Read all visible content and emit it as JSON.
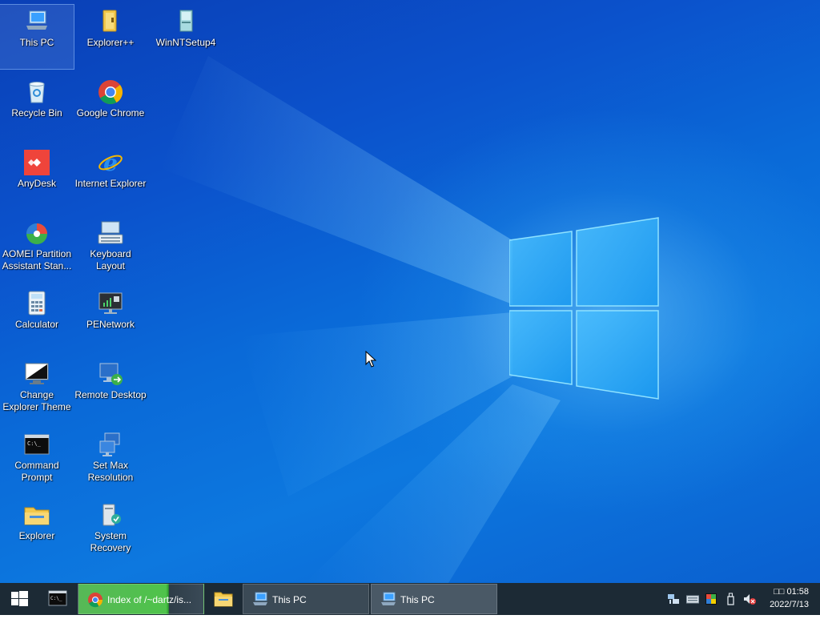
{
  "desktop": {
    "icons": [
      {
        "id": "this-pc",
        "label": "This PC",
        "icon": "computer-icon"
      },
      {
        "id": "explorerpp",
        "label": "Explorer++",
        "icon": "folder-icon"
      },
      {
        "id": "winntsetup",
        "label": "WinNTSetup4",
        "icon": "setup-disc-icon"
      },
      {
        "id": "recycle-bin",
        "label": "Recycle Bin",
        "icon": "recycle-bin-icon"
      },
      {
        "id": "google-chrome",
        "label": "Google Chrome",
        "icon": "chrome-icon"
      },
      {
        "id": "anydesk",
        "label": "AnyDesk",
        "icon": "anydesk-icon"
      },
      {
        "id": "internet-explorer",
        "label": "Internet Explorer",
        "icon": "ie-icon"
      },
      {
        "id": "aomei",
        "label": "AOMEI Partition Assistant Stan...",
        "icon": "aomei-icon"
      },
      {
        "id": "keyboard-layout",
        "label": "Keyboard Layout",
        "icon": "keyboard-icon"
      },
      {
        "id": "calculator",
        "label": "Calculator",
        "icon": "calculator-icon"
      },
      {
        "id": "penetwork",
        "label": "PENetwork",
        "icon": "network-monitor-icon"
      },
      {
        "id": "change-explorer-theme",
        "label": "Change Explorer Theme",
        "icon": "theme-icon"
      },
      {
        "id": "remote-desktop",
        "label": "Remote Desktop",
        "icon": "remote-desktop-icon"
      },
      {
        "id": "command-prompt",
        "label": "Command Prompt",
        "icon": "cmd-icon"
      },
      {
        "id": "set-max-resolution",
        "label": "Set Max Resolution",
        "icon": "resolution-icon"
      },
      {
        "id": "explorer",
        "label": "Explorer",
        "icon": "folder-icon"
      },
      {
        "id": "system-recovery",
        "label": "System Recovery",
        "icon": "recovery-icon"
      }
    ]
  },
  "taskbar": {
    "start_icon": "windows-start-icon",
    "pinned_cmd_icon": "cmd-icon",
    "tasks": [
      {
        "label": "Index of /~dartz/is...",
        "icon": "chrome-icon",
        "active": true
      },
      {
        "label": "This PC",
        "icon": "computer-icon",
        "active": false
      },
      {
        "label": "This PC",
        "icon": "computer-icon",
        "active": false
      }
    ],
    "tray": {
      "icons": [
        "network-icon",
        "keyboard-icon",
        "color-icon",
        "usb-icon",
        "volume-muted-icon"
      ],
      "time": "□□ 01:58",
      "date": "2022/7/13"
    }
  },
  "colors": {
    "taskbar": "#1c2a35",
    "active_task": "#4fc34b",
    "desktop_dark": "#0a3fb6",
    "desktop_light": "#0d78df"
  }
}
